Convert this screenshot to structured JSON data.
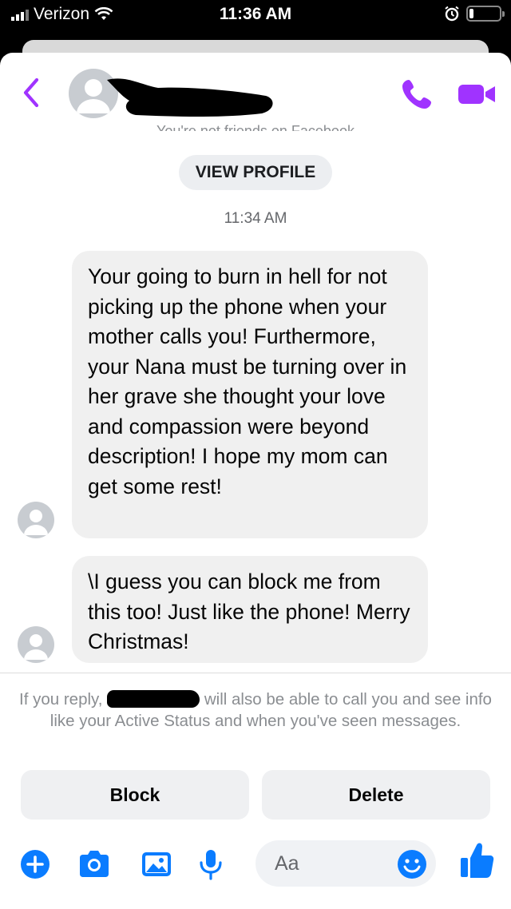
{
  "status_bar": {
    "carrier": "Verizon",
    "time": "11:36 AM"
  },
  "header": {
    "contact_name": "",
    "friends_note": "You're not friends on Facebook"
  },
  "conversation": {
    "view_profile_label": "VIEW PROFILE",
    "timestamp": "11:34 AM",
    "messages": [
      {
        "text": "Your going to burn in hell for not picking up the phone when your mother calls you! Furthermore, your Nana must be turning over in her grave she thought your love and compassion were beyond description! I hope my mom can get some rest!"
      },
      {
        "text": "\\I guess you can block me from this too! Just like the phone! Merry Christmas!"
      }
    ]
  },
  "reply_notice": {
    "prefix": "If you reply, ",
    "suffix": " will also be able to call you and see info like your Active Status and when you've seen messages."
  },
  "actions": {
    "block_label": "Block",
    "delete_label": "Delete"
  },
  "composer": {
    "placeholder": "Aa",
    "icons": [
      "plus-icon",
      "camera-icon",
      "photo-icon",
      "microphone-icon",
      "emoji-icon",
      "thumbs-up-icon"
    ]
  },
  "colors": {
    "accent_purple": "#a033ff",
    "accent_blue": "#0a7cff",
    "bubble_gray": "#f0f0f0",
    "secondary_text": "#8a8d91"
  }
}
